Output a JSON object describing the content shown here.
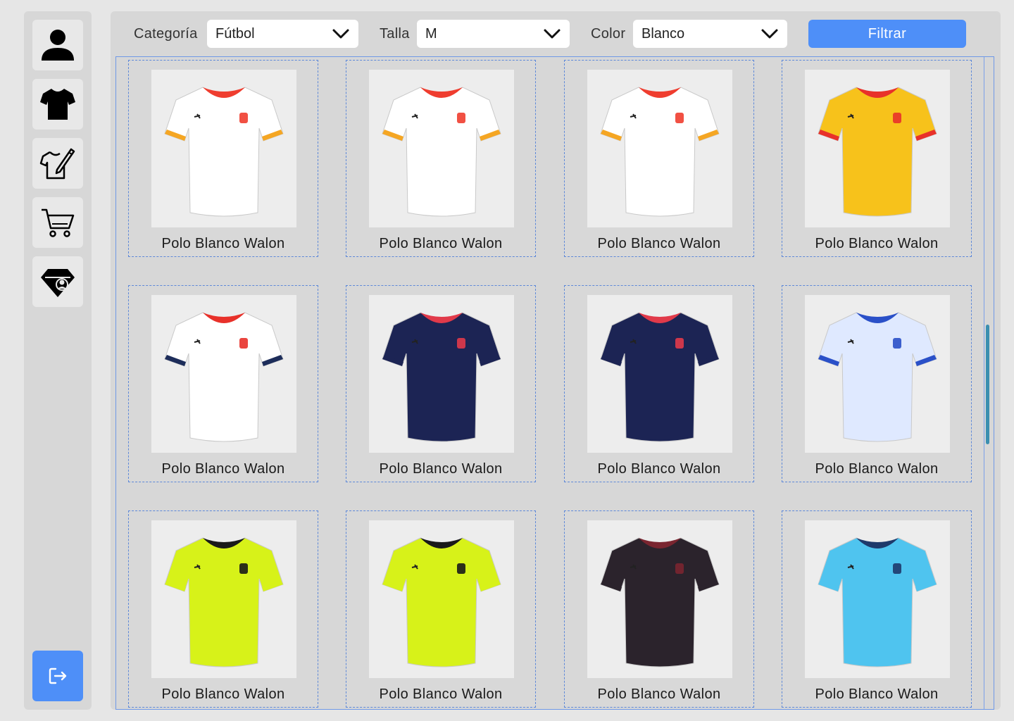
{
  "sidebar": {
    "items": [
      {
        "icon": "user-icon"
      },
      {
        "icon": "tshirt-icon"
      },
      {
        "icon": "design-shirt-icon"
      },
      {
        "icon": "cart-icon"
      },
      {
        "icon": "profile-badge-icon"
      }
    ],
    "logout_icon": "logout-icon",
    "accent": "#4e8ff8"
  },
  "filters": {
    "category_label": "Categoría",
    "category_value": "Fútbol",
    "size_label": "Talla",
    "size_value": "M",
    "color_label": "Color",
    "color_value": "Blanco",
    "submit_label": "Filtrar"
  },
  "products": [
    {
      "name": "Polo Blanco Walon",
      "colors": [
        "#ffffff",
        "#ef3d2f",
        "#f5a623"
      ]
    },
    {
      "name": "Polo Blanco Walon",
      "colors": [
        "#ffffff",
        "#ef3d2f",
        "#f5a623"
      ]
    },
    {
      "name": "Polo Blanco Walon",
      "colors": [
        "#ffffff",
        "#ef3d2f",
        "#f5a623"
      ]
    },
    {
      "name": "Polo Blanco Walon",
      "colors": [
        "#f7c21b",
        "#e8312a",
        "#e8312a"
      ]
    },
    {
      "name": "Polo Blanco Walon",
      "colors": [
        "#ffffff",
        "#e8312a",
        "#1d2d5a"
      ]
    },
    {
      "name": "Polo Blanco Walon",
      "colors": [
        "#1c2454",
        "#e13a4a",
        "#1c2454"
      ]
    },
    {
      "name": "Polo Blanco Walon",
      "colors": [
        "#1c2454",
        "#e13a4a",
        "#1c2454"
      ]
    },
    {
      "name": "Polo Blanco Walon",
      "colors": [
        "#dfe9ff",
        "#2a50c8",
        "#2a50c8"
      ]
    },
    {
      "name": "Polo Blanco Walon",
      "colors": [
        "#d7f219",
        "#1a1a1a",
        "#d7f219"
      ]
    },
    {
      "name": "Polo Blanco Walon",
      "colors": [
        "#d7f219",
        "#1a1a1a",
        "#d7f219"
      ]
    },
    {
      "name": "Polo Blanco Walon",
      "colors": [
        "#2b232c",
        "#7a2530",
        "#2b232c"
      ]
    },
    {
      "name": "Polo Blanco Walon",
      "colors": [
        "#4fc4ef",
        "#1e3a6b",
        "#4fc4ef"
      ]
    }
  ]
}
